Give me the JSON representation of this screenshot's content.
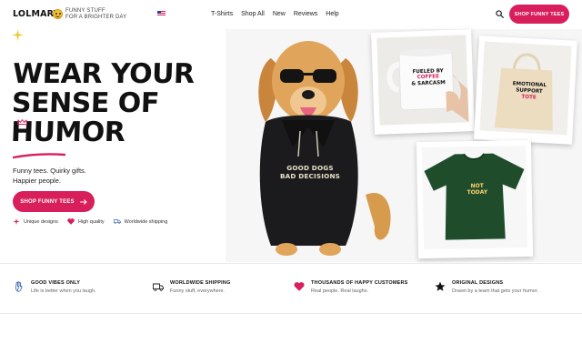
{
  "header": {
    "logo": "LOLMART",
    "tagline": [
      "FUNNY STUFF",
      "FOR A BRIGHTER DAY"
    ],
    "nav": [
      "T-Shirts",
      "Shop All",
      "New",
      "Reviews",
      "Help"
    ],
    "cta": "SHOP FUNNY TEES"
  },
  "hero": {
    "title": [
      "WEAR YOUR",
      "SENSE OF",
      "HUMOR"
    ],
    "subtext": [
      "Funny tees. Quirky gifts.",
      "Happier people."
    ],
    "cta": "SHOP FUNNY TEES",
    "perks": [
      "Unique designs",
      "High quality",
      "Worldwide shipping"
    ]
  },
  "products": {
    "hoodie": [
      "GOOD DOGS",
      "BAD DECISIONS"
    ],
    "mug": [
      "FUELED BY",
      "COFFEE",
      "& SARCASM"
    ],
    "tote": [
      "EMOTIONAL",
      "SUPPORT",
      "TOTE"
    ],
    "tee": [
      "NOT",
      "TODAY"
    ]
  },
  "features": [
    {
      "title": "GOOD VIBES ONLY",
      "desc": "Life is better when you laugh.",
      "icon": "hand-wave-icon"
    },
    {
      "title": "WORLDWIDE SHIPPING",
      "desc": "Funny stuff, everywhere.",
      "icon": "truck-icon"
    },
    {
      "title": "THOUSANDS OF HAPPY CUSTOMERS",
      "desc": "Real people. Real laughs.",
      "icon": "heart-icon"
    },
    {
      "title": "ORIGINAL DESIGNS",
      "desc": "Drawn by a team that gets your humor.",
      "icon": "star-icon"
    }
  ],
  "colors": {
    "accent": "#d81e5b",
    "text": "#111111",
    "tee": "#1f4d2c"
  }
}
